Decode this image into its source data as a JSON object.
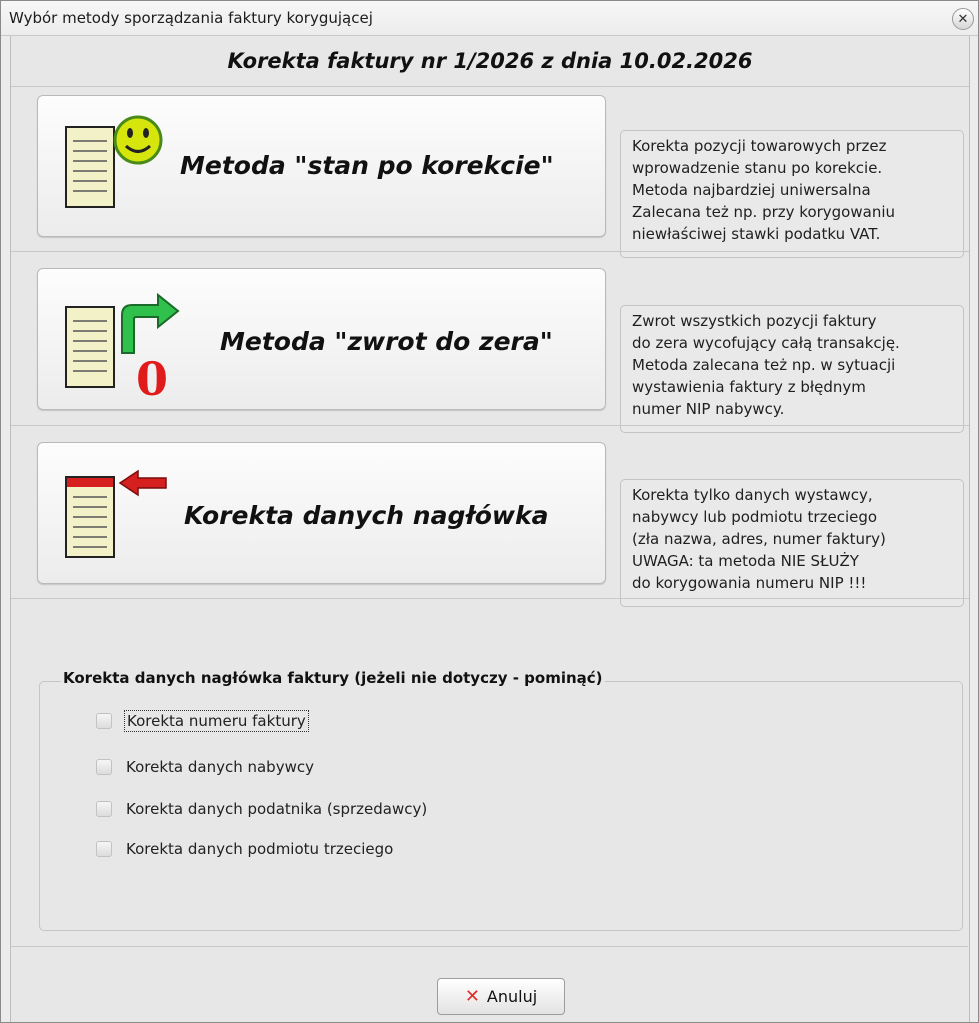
{
  "window": {
    "title": "Wybór metody sporządzania faktury korygującej",
    "close_symbol": "✕"
  },
  "heading": "Korekta faktury nr 1/2026 z dnia 10.02.2026",
  "methods": [
    {
      "label": "Metoda \"stan po korekcie\"",
      "icon": "document-smiley-icon",
      "description": [
        "Korekta pozycji towarowych przez",
        "wprowadzenie stanu po korekcie.",
        "Metoda najbardziej uniwersalna",
        "Zalecana też np. przy korygowaniu",
        "niewłaściwej stawki podatku VAT."
      ]
    },
    {
      "label": "Metoda \"zwrot do zera\"",
      "icon": "document-return-zero-icon",
      "icon_text": "0",
      "description": [
        "Zwrot wszystkich pozycji faktury",
        "do zera wycofujący całą transakcję.",
        "Metoda zalecana też np. w sytuacji",
        "wystawienia faktury z błędnym",
        "numer NIP nabywcy."
      ]
    },
    {
      "label": "Korekta danych nagłówka",
      "icon": "document-header-arrow-icon",
      "description": [
        "Korekta tylko danych wystawcy,",
        "nabywcy lub podmiotu trzeciego",
        "(zła nazwa, adres, numer faktury)",
        "UWAGA: ta metoda NIE SŁUŻY",
        "do korygowania numeru NIP !!!"
      ]
    }
  ],
  "header_group": {
    "title": "Korekta danych nagłówka faktury (jeżeli nie dotyczy - pominąć)",
    "options": [
      {
        "label": "Korekta numeru faktury",
        "checked": false
      },
      {
        "label": "Korekta danych nabywcy",
        "checked": false
      },
      {
        "label": "Korekta danych podatnika (sprzedawcy)",
        "checked": false
      },
      {
        "label": "Korekta danych podmiotu trzeciego",
        "checked": false
      }
    ]
  },
  "cancel_button": {
    "label": "Anuluj",
    "icon": "red-x-icon"
  },
  "colors": {
    "smiley": "#d6e60c",
    "arrow_green": "#2fc14b",
    "zero_red": "#e01b1b",
    "arrow_red": "#d61f1f",
    "cancel_x": "#d9302a"
  }
}
